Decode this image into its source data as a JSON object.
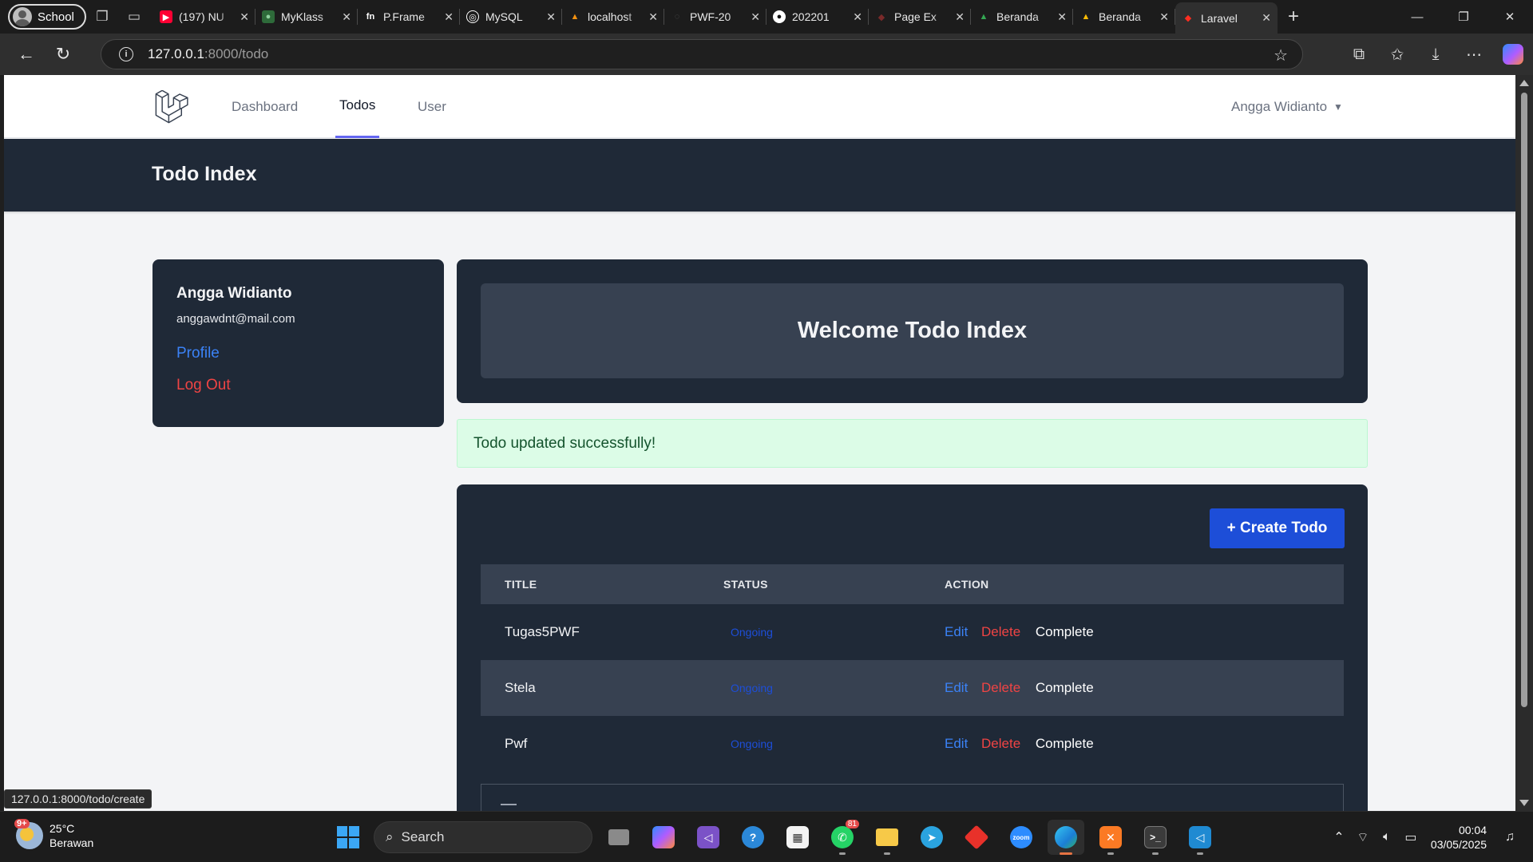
{
  "browser": {
    "profile_label": "School",
    "tabs": [
      {
        "label": "(197) NU",
        "color": "#ff0033",
        "glyph": "▶"
      },
      {
        "label": "MyKlass",
        "color": "#2e6b3a",
        "glyph": "●"
      },
      {
        "label": "P.Frame",
        "color": "#3a3a3a",
        "glyph": "fn"
      },
      {
        "label": "MySQL",
        "color": "#3a3a3a",
        "glyph": "◎"
      },
      {
        "label": "localhost",
        "color": "#f29111",
        "glyph": "▲"
      },
      {
        "label": "PWF-20",
        "color": "#333333",
        "glyph": "◌"
      },
      {
        "label": "202201",
        "color": "#333333",
        "glyph": "●"
      },
      {
        "label": "Page Ex",
        "color": "#ff2d20",
        "glyph": "◆"
      },
      {
        "label": "Beranda",
        "color": "#1a73e8",
        "glyph": "▲"
      },
      {
        "label": "Beranda",
        "color": "#1a73e8",
        "glyph": "▲"
      },
      {
        "label": "Laravel",
        "color": "#ff2d20",
        "glyph": "◆",
        "active": true
      }
    ],
    "url_host": "127.0.0.1",
    "url_rest": ":8000/todo",
    "status_url": "127.0.0.1:8000/todo/create"
  },
  "app": {
    "nav": {
      "dashboard": "Dashboard",
      "todos": "Todos",
      "user": "User",
      "user_name": "Angga Widianto"
    },
    "header_title": "Todo Index",
    "sidebar": {
      "name": "Angga Widianto",
      "email": "anggawdnt@mail.com",
      "profile": "Profile",
      "logout": "Log Out"
    },
    "welcome": "Welcome Todo Index",
    "alert": "Todo updated successfully!",
    "create_button": "+ Create Todo",
    "table": {
      "headers": [
        "Title",
        "Status",
        "Action"
      ],
      "rows": [
        {
          "title": "Tugas5PWF",
          "status": "Ongoing"
        },
        {
          "title": "Stela",
          "status": "Ongoing"
        },
        {
          "title": "Pwf",
          "status": "Ongoing"
        }
      ],
      "actions": {
        "edit": "Edit",
        "delete": "Delete",
        "complete": "Complete"
      }
    }
  },
  "taskbar": {
    "weather_badge": "9+",
    "weather_temp": "25°C",
    "weather_desc": "Berawan",
    "search_label": "Search",
    "whatsapp_count": "81",
    "time": "00:04",
    "date": "03/05/2025"
  }
}
